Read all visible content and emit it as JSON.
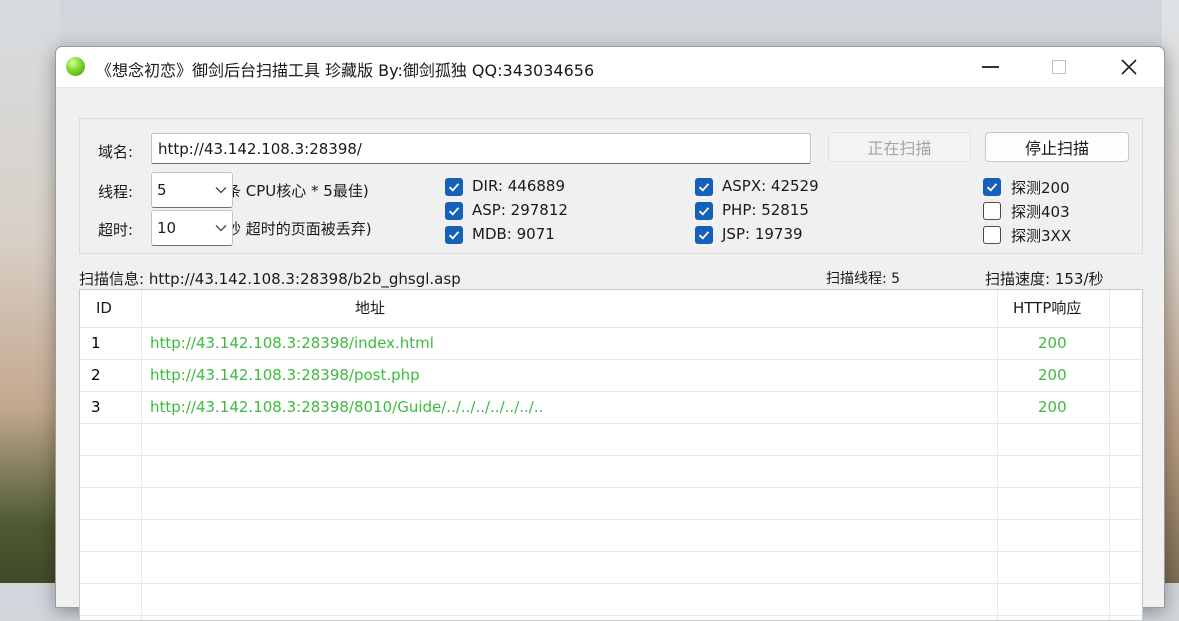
{
  "window": {
    "title": "《想念初恋》御剑后台扫描工具 珍藏版 By:御剑孤独 QQ:343034656"
  },
  "form": {
    "domain_label": "域名:",
    "domain_value": "http://43.142.108.3:28398/",
    "scanning_button": "正在扫描",
    "stop_button": "停止扫描",
    "threads_label": "线程:",
    "threads_value": "5",
    "threads_hint": "条 CPU核心 * 5最佳)",
    "timeout_label": "超时:",
    "timeout_value": "10",
    "timeout_hint": "秒 超时的页面被丢弃)"
  },
  "dictionaries": [
    {
      "label": "DIR:  446889",
      "checked": true
    },
    {
      "label": "ASP:  297812",
      "checked": true
    },
    {
      "label": "MDB:  9071",
      "checked": true
    },
    {
      "label": "ASPX:  42529",
      "checked": true
    },
    {
      "label": "PHP:  52815",
      "checked": true
    },
    {
      "label": "JSP:  19739",
      "checked": true
    }
  ],
  "probes": [
    {
      "label": "探测200",
      "checked": true
    },
    {
      "label": "探测403",
      "checked": false
    },
    {
      "label": "探测3XX",
      "checked": false
    }
  ],
  "status": {
    "scan_info": "扫描信息:  http://43.142.108.3:28398/b2b_ghsgl.asp",
    "scan_threads": "扫描线程:  5",
    "scan_speed": "扫描速度:  153/秒"
  },
  "table": {
    "columns": [
      "ID",
      "地址",
      "HTTP响应"
    ],
    "rows": [
      {
        "id": "1",
        "url": "http://43.142.108.3:28398/index.html",
        "code": "200"
      },
      {
        "id": "2",
        "url": "http://43.142.108.3:28398/post.php",
        "code": "200"
      },
      {
        "id": "3",
        "url": "http://43.142.108.3:28398/8010/Guide/../../../../../../..",
        "code": "200"
      }
    ]
  },
  "colors": {
    "accent": "#1660b8",
    "success_text": "#3dbb3d"
  }
}
